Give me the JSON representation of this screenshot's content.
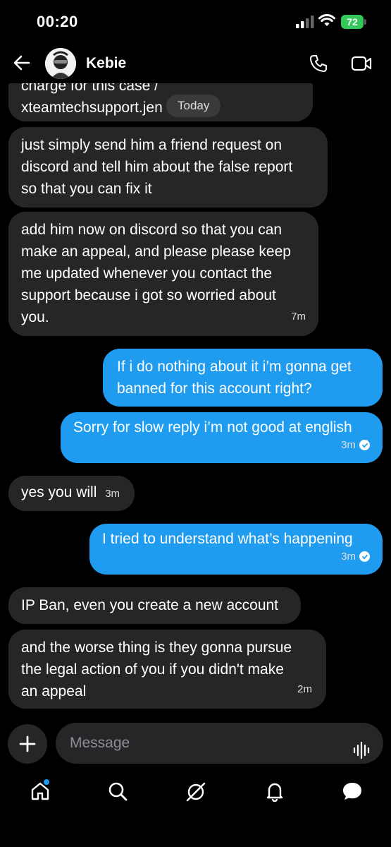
{
  "status": {
    "time": "00:20",
    "battery": "72"
  },
  "header": {
    "contact_name": "Kebie"
  },
  "chat": {
    "date_pill": "Today",
    "messages": [
      {
        "side": "received",
        "text_lines": [
          "charge for this case /",
          "xteamtechsupport.jen"
        ],
        "time": ""
      },
      {
        "side": "received",
        "text_lines": [
          "just simply send him a friend request on",
          "discord and tell him about the false report",
          "so that you can fix it"
        ],
        "time": ""
      },
      {
        "side": "received",
        "text_lines": [
          "add him now on discord so that you can",
          "make an appeal, and please please keep",
          "me updated whenever you contact the",
          "support because i got so worried about",
          "you."
        ],
        "time": "7m"
      },
      {
        "side": "sent",
        "text_lines": [
          "If i do nothing about it i’m gonna get",
          "banned for this account right?"
        ],
        "time": ""
      },
      {
        "side": "sent",
        "text_lines": [
          "Sorry for slow reply i’m not good at english"
        ],
        "time": "3m"
      },
      {
        "side": "received",
        "text_lines": [
          "yes you will"
        ],
        "time": "3m"
      },
      {
        "side": "sent",
        "text_lines": [
          "I tried to understand what’s happening"
        ],
        "time": "3m"
      },
      {
        "side": "received",
        "text_lines": [
          "IP Ban, even you create a new account"
        ],
        "time": ""
      },
      {
        "side": "received",
        "text_lines": [
          "and the worse thing is they gonna pursue",
          "the legal action of you if you didn't make",
          "an appeal"
        ],
        "time": "2m"
      }
    ]
  },
  "composer": {
    "placeholder": "Message"
  },
  "nav": {
    "items": [
      "home-icon",
      "search-icon",
      "explore-icon",
      "notifications-icon",
      "messages-icon"
    ]
  },
  "colors": {
    "sent_bubble": "#1f9cf0",
    "received_bubble": "#262629",
    "background": "#000000"
  }
}
